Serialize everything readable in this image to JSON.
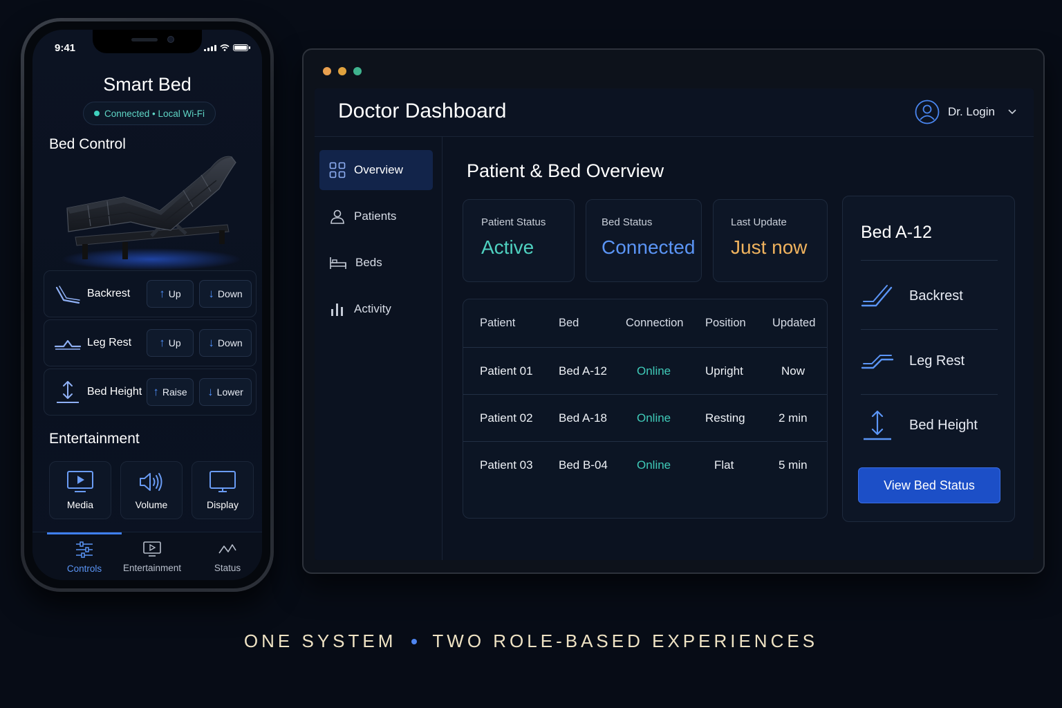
{
  "phone": {
    "status_time": "9:41",
    "app_title": "Smart Bed",
    "connection_status": "Connected • Local Wi-Fi",
    "bed_control_title": "Bed Control",
    "controls": [
      {
        "label": "Backrest",
        "up_label": "Up",
        "down_label": "Down",
        "icon": "backrest-icon"
      },
      {
        "label": "Leg Rest",
        "up_label": "Up",
        "down_label": "Down",
        "icon": "leg-rest-icon"
      },
      {
        "label": "Bed Height",
        "up_label": "Raise",
        "down_label": "Lower",
        "icon": "bed-height-icon"
      }
    ],
    "entertainment_title": "Entertainment",
    "entertainment": [
      {
        "label": "Media",
        "icon": "media-icon"
      },
      {
        "label": "Volume",
        "icon": "volume-icon"
      },
      {
        "label": "Display",
        "icon": "display-icon"
      }
    ],
    "tabs": [
      {
        "label": "Controls",
        "icon": "sliders-icon",
        "active": true
      },
      {
        "label": "Entertainment",
        "icon": "tv-icon",
        "active": false
      },
      {
        "label": "Status",
        "icon": "pulse-icon",
        "active": false
      }
    ]
  },
  "dashboard": {
    "title": "Doctor Dashboard",
    "user_label": "Dr. Login",
    "nav": [
      {
        "label": "Overview",
        "icon": "grid-icon",
        "active": true
      },
      {
        "label": "Patients",
        "icon": "user-icon",
        "active": false
      },
      {
        "label": "Beds",
        "icon": "bed-icon",
        "active": false
      },
      {
        "label": "Activity",
        "icon": "bar-chart-icon",
        "active": false
      }
    ],
    "main_title": "Patient & Bed Overview",
    "stats": [
      {
        "label": "Patient Status",
        "value": "Active",
        "color": "#4fd1c0"
      },
      {
        "label": "Bed Status",
        "value": "Connected",
        "color": "#5b95f6"
      },
      {
        "label": "Last Update",
        "value": "Just now",
        "color": "#f0b35e"
      }
    ],
    "table": {
      "headers": [
        "Patient",
        "Bed",
        "Connection",
        "Position",
        "Updated"
      ],
      "rows": [
        [
          "Patient 01",
          "Bed A-12",
          "Online",
          "Upright",
          "Now"
        ],
        [
          "Patient 02",
          "Bed A-18",
          "Online",
          "Resting",
          "2 min"
        ],
        [
          "Patient 03",
          "Bed B-04",
          "Online",
          "Flat",
          "5 min"
        ]
      ]
    },
    "bed_panel": {
      "title": "Bed A-12",
      "items": [
        {
          "label": "Backrest",
          "icon": "backrest-icon"
        },
        {
          "label": "Leg Rest",
          "icon": "leg-rest-icon"
        },
        {
          "label": "Bed Height",
          "icon": "bed-height-icon"
        }
      ],
      "button_label": "View Bed Status"
    }
  },
  "tagline": {
    "left": "ONE SYSTEM",
    "right": "TWO ROLE-BASED EXPERIENCES"
  },
  "colors": {
    "accent_blue": "#3f7ff0",
    "online_teal": "#3fcab8",
    "highlight_amber": "#f0b35e",
    "tagline_cream": "#efe3c4"
  }
}
